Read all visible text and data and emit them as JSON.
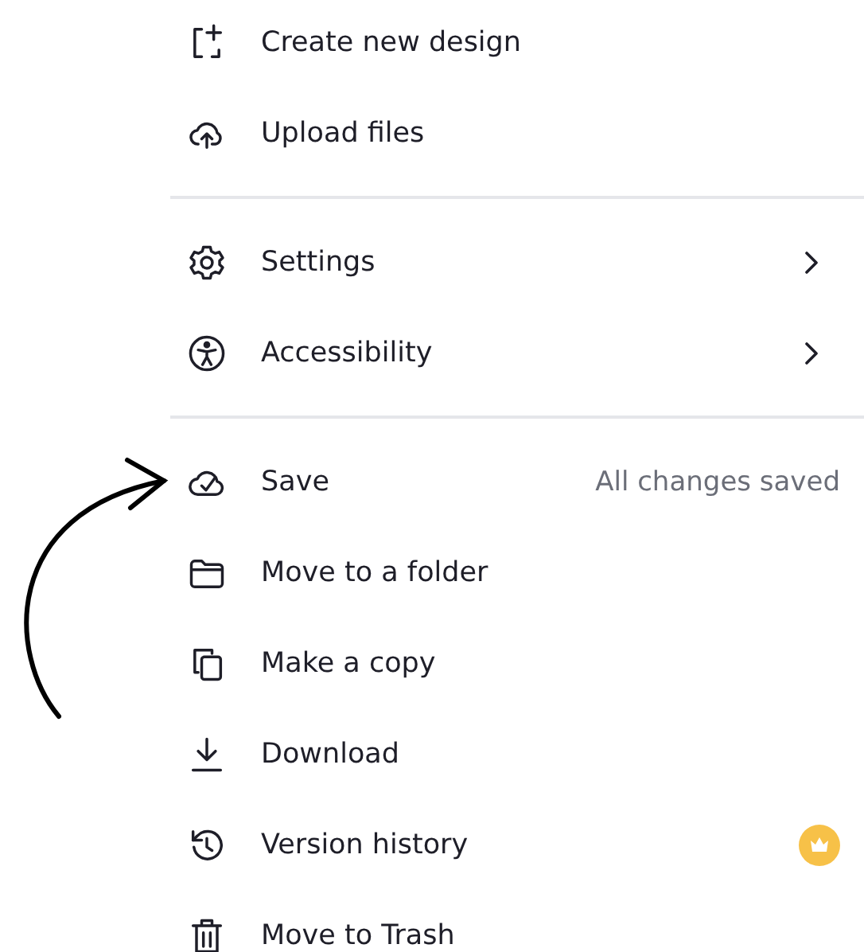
{
  "menu": {
    "groups": [
      {
        "items": [
          {
            "label": "Create new design",
            "kind": "plain"
          },
          {
            "label": "Upload files",
            "kind": "plain"
          }
        ]
      },
      {
        "items": [
          {
            "label": "Settings",
            "kind": "submenu"
          },
          {
            "label": "Accessibility",
            "kind": "submenu"
          }
        ]
      },
      {
        "items": [
          {
            "label": "Save",
            "kind": "status",
            "note": "All changes saved"
          },
          {
            "label": "Move to a folder",
            "kind": "plain"
          },
          {
            "label": "Make a copy",
            "kind": "plain"
          },
          {
            "label": "Download",
            "kind": "plain"
          },
          {
            "label": "Version history",
            "kind": "premium"
          },
          {
            "label": "Move to Trash",
            "kind": "plain"
          }
        ]
      }
    ]
  }
}
